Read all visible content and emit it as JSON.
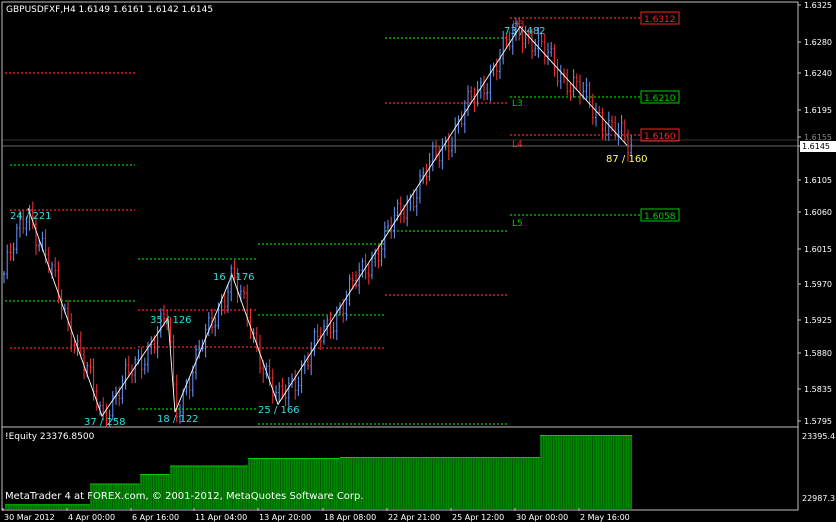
{
  "window": {
    "symbol_line": "GBPUSDFXF,H4  1.6149 1.6161 1.6142 1.6145",
    "copyright": "MetaTrader 4 at FOREX.com, © 2001-2012, MetaQuotes Software Corp."
  },
  "colors": {
    "background": "#000000",
    "bull": "#6699ff",
    "bear": "#ff3333",
    "support": "#00cc00",
    "resistance": "#ff2222",
    "zigzag": "#ffffff",
    "wave_label": "#33dddd",
    "last_wave_label": "#ffff66",
    "equity_fill": "#008800",
    "equity_top": "#00cc00"
  },
  "price_axis": {
    "labels": [
      "1.6325",
      "1.6280",
      "1.6240",
      "1.6195",
      "1.6155",
      "1.6145",
      "1.6105",
      "1.6060",
      "1.6015",
      "1.5970",
      "1.5925",
      "1.5880",
      "1.5835",
      "1.5795"
    ],
    "current_price": "1.6145"
  },
  "time_axis": {
    "labels": [
      "30 Mar 2012",
      "4 Apr 00:00",
      "6 Apr 16:00",
      "11 Apr 04:00",
      "13 Apr 20:00",
      "18 Apr 08:00",
      "22 Apr 21:00",
      "25 Apr 12:00",
      "30 Apr 00:00",
      "2 May 16:00"
    ]
  },
  "wave_labels": [
    {
      "text": "24 / 221",
      "kind": "peak"
    },
    {
      "text": "37 / 258",
      "kind": "trough"
    },
    {
      "text": "35 / 126",
      "kind": "peak"
    },
    {
      "text": "18 / 122",
      "kind": "trough"
    },
    {
      "text": "16 / 176",
      "kind": "peak"
    },
    {
      "text": "25 / 166",
      "kind": "trough"
    },
    {
      "text": "73 / 482",
      "kind": "peak"
    },
    {
      "text": "87 / 160",
      "kind": "last"
    }
  ],
  "level_markers": [
    {
      "text": "H3",
      "type": "resistance"
    },
    {
      "text": "L3",
      "type": "support"
    },
    {
      "text": "L4",
      "type": "resistance"
    },
    {
      "text": "L5",
      "type": "support"
    }
  ],
  "level_boxes": [
    {
      "text": "1.6312",
      "price": 1.6312,
      "type": "resistance"
    },
    {
      "text": "1.6210",
      "price": 1.621,
      "type": "support"
    },
    {
      "text": "1.6160",
      "price": 1.616,
      "type": "resistance"
    },
    {
      "text": "1.6058",
      "price": 1.6058,
      "type": "support"
    }
  ],
  "equity": {
    "label": "!Equity 23376.8500",
    "axis_high": "23395.4",
    "axis_low": "22987.3",
    "steps": [
      {
        "value": 23010
      },
      {
        "value": 23120
      },
      {
        "value": 23170
      },
      {
        "value": 23215
      },
      {
        "value": 23255
      },
      {
        "value": 23260
      },
      {
        "value": 23376.85
      }
    ]
  },
  "chart_data": {
    "type": "candlestick",
    "symbol": "GBPUSDFXF",
    "timeframe": "H4",
    "ylim": [
      1.579,
      1.6335
    ],
    "x": [
      "30 Mar 2012",
      "4 Apr 00:00",
      "6 Apr 16:00",
      "11 Apr 04:00",
      "13 Apr 20:00",
      "18 Apr 08:00",
      "22 Apr 21:00",
      "25 Apr 12:00",
      "30 Apr 00:00",
      "2 May 16:00"
    ],
    "zigzag": [
      {
        "label": "24 / 221",
        "price": 1.6065
      },
      {
        "label": "37 / 258",
        "price": 1.58
      },
      {
        "label": "35 / 126",
        "price": 1.5925
      },
      {
        "label": "18 / 122",
        "price": 1.5805
      },
      {
        "label": "16 / 176",
        "price": 1.598
      },
      {
        "label": "25 / 166",
        "price": 1.5815
      },
      {
        "label": "73 / 482",
        "price": 1.6296
      },
      {
        "label": "87 / 160",
        "price": 1.6145
      }
    ],
    "last": {
      "open": 1.6149,
      "high": 1.6161,
      "low": 1.6142,
      "close": 1.6145
    }
  }
}
